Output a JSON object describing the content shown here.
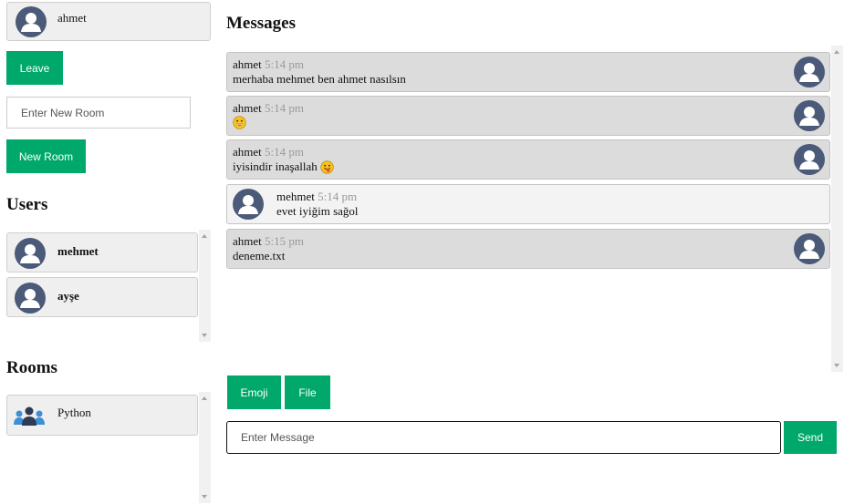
{
  "current_user": {
    "name": "ahmet"
  },
  "controls": {
    "leave_label": "Leave",
    "room_input_placeholder": "Enter New Room",
    "new_room_label": "New Room"
  },
  "users": {
    "heading": "Users",
    "items": [
      {
        "name": "mehmet"
      },
      {
        "name": "ayşe"
      }
    ]
  },
  "rooms": {
    "heading": "Rooms",
    "items": [
      {
        "name": "Python",
        "icon": "group-icon"
      }
    ]
  },
  "messages": {
    "heading": "Messages",
    "items": [
      {
        "sender": "ahmet",
        "time": "5:14 pm",
        "text": "merhaba mehmet ben ahmet nasılsın",
        "emoji": "",
        "own": true
      },
      {
        "sender": "ahmet",
        "time": "5:14 pm",
        "text": "",
        "emoji": "grinning-face-emoji",
        "own": true
      },
      {
        "sender": "ahmet",
        "time": "5:14 pm",
        "text": "iyisindir inaşallah",
        "emoji": "tongue-face-emoji",
        "own": true
      },
      {
        "sender": "mehmet",
        "time": "5:14 pm",
        "text": "evet iyiğim sağol",
        "emoji": "",
        "own": false
      },
      {
        "sender": "ahmet",
        "time": "5:15 pm",
        "text": "deneme.txt",
        "emoji": "",
        "own": true
      }
    ]
  },
  "composer": {
    "emoji_label": "Emoji",
    "file_label": "File",
    "message_placeholder": "Enter Message",
    "send_label": "Send"
  },
  "colors": {
    "accent": "#00a86b",
    "avatar": "#4a5a78",
    "own_message_bg": "#dcdcdc",
    "other_message_bg": "#f3f3f3"
  }
}
